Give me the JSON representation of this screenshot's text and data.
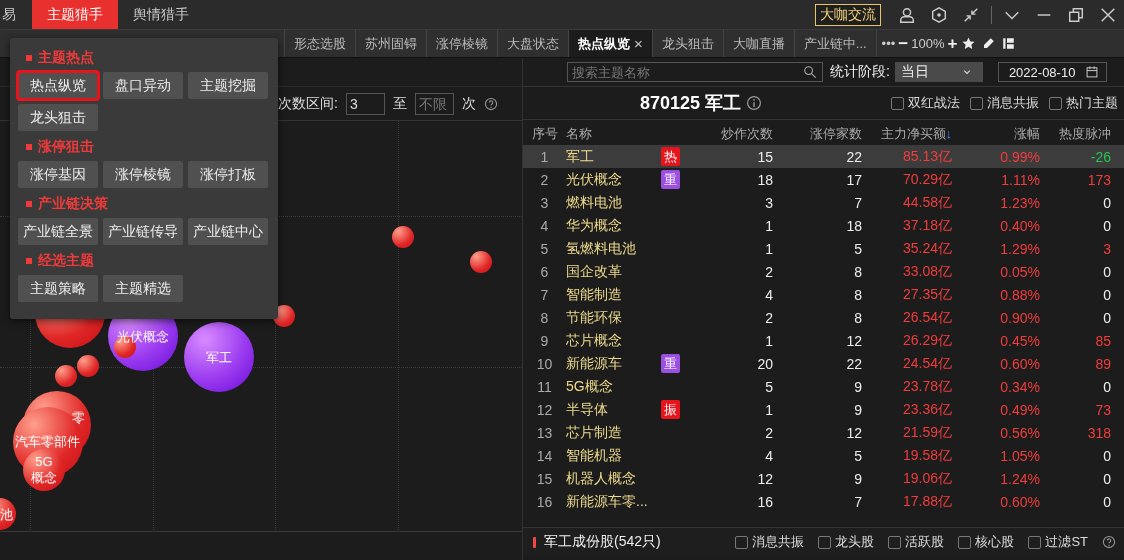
{
  "top_menu": [
    {
      "label": "易",
      "selected": false
    },
    {
      "label": "主题猎手",
      "selected": true
    },
    {
      "label": "舆情猎手",
      "selected": false
    }
  ],
  "top_button": "大咖交流",
  "tabs": [
    {
      "label": "形态选股",
      "selected": false,
      "closable": false
    },
    {
      "label": "苏州固锝",
      "selected": false,
      "closable": false
    },
    {
      "label": "涨停棱镜",
      "selected": false,
      "closable": false
    },
    {
      "label": "大盘状态",
      "selected": false,
      "closable": false
    },
    {
      "label": "热点纵览",
      "selected": true,
      "closable": true,
      "close": "×"
    },
    {
      "label": "龙头狙击",
      "selected": false,
      "closable": false
    },
    {
      "label": "大咖直播",
      "selected": false,
      "closable": false
    },
    {
      "label": "产业链中...",
      "selected": false,
      "closable": false
    }
  ],
  "zoom": {
    "more": "•••",
    "minus": "−",
    "value": "100%",
    "plus": "+"
  },
  "menu": {
    "sections": [
      {
        "title": "主题热点",
        "items": [
          {
            "label": "热点纵览",
            "selected": true
          },
          {
            "label": "盘口异动",
            "selected": false
          },
          {
            "label": "主题挖掘",
            "selected": false
          },
          {
            "label": "龙头狙击",
            "selected": false
          }
        ]
      },
      {
        "title": "涨停狙击",
        "items": [
          {
            "label": "涨停基因",
            "selected": false
          },
          {
            "label": "涨停棱镜",
            "selected": false
          },
          {
            "label": "涨停打板",
            "selected": false
          }
        ]
      },
      {
        "title": "产业链决策",
        "items": [
          {
            "label": "产业链全景",
            "selected": false
          },
          {
            "label": "产业链传导",
            "selected": false
          },
          {
            "label": "产业链中心",
            "selected": false
          }
        ]
      },
      {
        "title": "经选主题",
        "items": [
          {
            "label": "主题策略",
            "selected": false
          },
          {
            "label": "主题精选",
            "selected": false
          }
        ]
      }
    ]
  },
  "filter": {
    "label": "次数区间:",
    "from": "3",
    "to_label": "至",
    "to_placeholder": "不限",
    "unit": "次"
  },
  "bubbles": [
    {
      "label": "光伏概念",
      "kind": "violet"
    },
    {
      "label": "军工",
      "kind": "violet"
    },
    {
      "label": "零",
      "kind": "red"
    },
    {
      "label": "汽车零部件",
      "kind": "red"
    },
    {
      "label": "5G概念",
      "kind": "red"
    },
    {
      "label": "池",
      "kind": "red"
    }
  ],
  "search": {
    "placeholder": "搜索主题名称"
  },
  "period": {
    "label": "统计阶段:",
    "value": "当日"
  },
  "date": "2022-08-10",
  "theme_title": "870125 军工",
  "options": [
    {
      "label": "双红战法",
      "checked": false
    },
    {
      "label": "消息共振",
      "checked": false
    },
    {
      "label": "热门主题",
      "checked": false
    }
  ],
  "table": {
    "columns": [
      "序号",
      "名称",
      "炒作次数",
      "涨停家数",
      "主力净买额",
      "涨幅",
      "热度脉冲"
    ],
    "sort_mark": "↓",
    "rows": [
      {
        "no": "1",
        "name": "军工",
        "tag": {
          "text": "热",
          "color": "#e8141b"
        },
        "times": "15",
        "limit_up": "22",
        "net_buy": "85.13亿",
        "change": "0.99%",
        "pulse": {
          "text": "-26",
          "color": "#23c653"
        },
        "selected": true
      },
      {
        "no": "2",
        "name": "光伏概念",
        "tag": {
          "text": "重",
          "color": "#9b4fe0"
        },
        "times": "18",
        "limit_up": "17",
        "net_buy": "70.29亿",
        "change": "1.11%",
        "pulse": {
          "text": "173",
          "color": "#f23c3c"
        },
        "selected": false
      },
      {
        "no": "3",
        "name": "燃料电池",
        "times": "3",
        "limit_up": "7",
        "net_buy": "44.58亿",
        "change": "1.23%",
        "pulse": {
          "text": "0",
          "color": "#eeeeee"
        },
        "selected": false
      },
      {
        "no": "4",
        "name": "华为概念",
        "times": "1",
        "limit_up": "18",
        "net_buy": "37.18亿",
        "change": "0.40%",
        "pulse": {
          "text": "0",
          "color": "#eeeeee"
        },
        "selected": false
      },
      {
        "no": "5",
        "name": "氢燃料电池",
        "times": "1",
        "limit_up": "5",
        "net_buy": "35.24亿",
        "change": "1.29%",
        "pulse": {
          "text": "3",
          "color": "#f23c3c"
        },
        "selected": false
      },
      {
        "no": "6",
        "name": "国企改革",
        "times": "2",
        "limit_up": "8",
        "net_buy": "33.08亿",
        "change": "0.05%",
        "pulse": {
          "text": "0",
          "color": "#eeeeee"
        },
        "selected": false
      },
      {
        "no": "7",
        "name": "智能制造",
        "times": "4",
        "limit_up": "8",
        "net_buy": "27.35亿",
        "change": "0.88%",
        "pulse": {
          "text": "0",
          "color": "#eeeeee"
        },
        "selected": false
      },
      {
        "no": "8",
        "name": "节能环保",
        "times": "2",
        "limit_up": "8",
        "net_buy": "26.54亿",
        "change": "0.90%",
        "pulse": {
          "text": "0",
          "color": "#eeeeee"
        },
        "selected": false
      },
      {
        "no": "9",
        "name": "芯片概念",
        "times": "1",
        "limit_up": "12",
        "net_buy": "26.29亿",
        "change": "0.45%",
        "pulse": {
          "text": "85",
          "color": "#f23c3c"
        },
        "selected": false
      },
      {
        "no": "10",
        "name": "新能源车",
        "tag": {
          "text": "重",
          "color": "#9b4fe0"
        },
        "times": "20",
        "limit_up": "22",
        "net_buy": "24.54亿",
        "change": "0.60%",
        "pulse": {
          "text": "89",
          "color": "#f23c3c"
        },
        "selected": false
      },
      {
        "no": "11",
        "name": "5G概念",
        "times": "5",
        "limit_up": "9",
        "net_buy": "23.78亿",
        "change": "0.34%",
        "pulse": {
          "text": "0",
          "color": "#eeeeee"
        },
        "selected": false
      },
      {
        "no": "12",
        "name": "半导体",
        "tag": {
          "text": "振",
          "color": "#e8141b"
        },
        "times": "1",
        "limit_up": "9",
        "net_buy": "23.36亿",
        "change": "0.49%",
        "pulse": {
          "text": "73",
          "color": "#f23c3c"
        },
        "selected": false
      },
      {
        "no": "13",
        "name": "芯片制造",
        "times": "2",
        "limit_up": "12",
        "net_buy": "21.59亿",
        "change": "0.56%",
        "pulse": {
          "text": "318",
          "color": "#f23c3c"
        },
        "selected": false
      },
      {
        "no": "14",
        "name": "智能机器",
        "times": "4",
        "limit_up": "5",
        "net_buy": "19.58亿",
        "change": "1.05%",
        "pulse": {
          "text": "0",
          "color": "#eeeeee"
        },
        "selected": false
      },
      {
        "no": "15",
        "name": "机器人概念",
        "times": "12",
        "limit_up": "9",
        "net_buy": "19.06亿",
        "change": "1.24%",
        "pulse": {
          "text": "0",
          "color": "#eeeeee"
        },
        "selected": false
      },
      {
        "no": "16",
        "name": "新能源车零...",
        "times": "16",
        "limit_up": "7",
        "net_buy": "17.88亿",
        "change": "0.60%",
        "pulse": {
          "text": "0",
          "color": "#eeeeee"
        },
        "selected": false
      }
    ]
  },
  "constituents": {
    "title": "军工成份股(542只)",
    "filters": [
      {
        "label": "消息共振",
        "checked": false
      },
      {
        "label": "龙头股",
        "checked": false
      },
      {
        "label": "活跃股",
        "checked": false
      },
      {
        "label": "核心股",
        "checked": false
      },
      {
        "label": "过滤ST",
        "checked": false
      }
    ]
  }
}
